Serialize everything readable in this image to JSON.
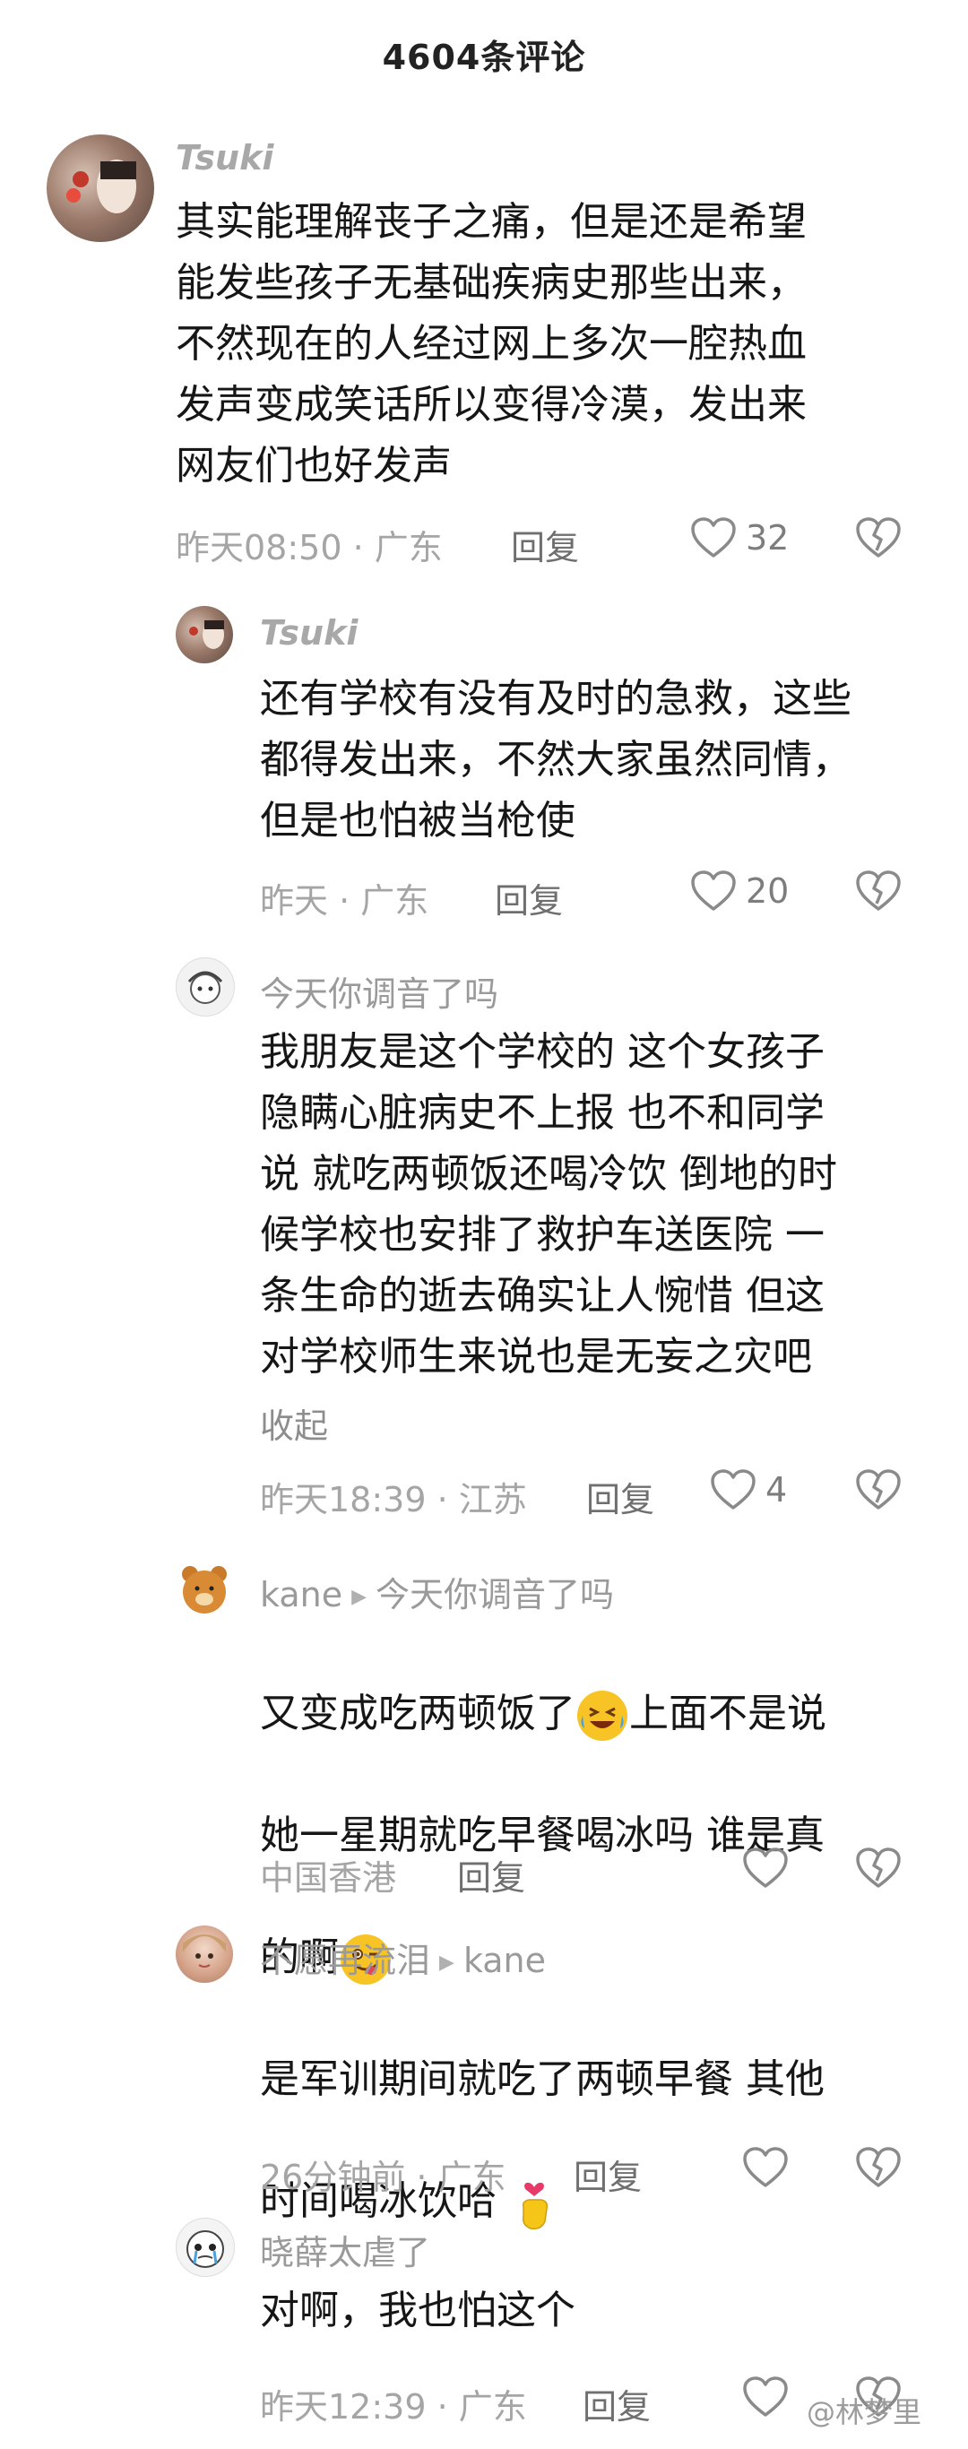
{
  "header": {
    "title": "4604条评论"
  },
  "comments": [
    {
      "user": "Tsuki",
      "text": "其实能理解丧子之痛，但是还是希望\n能发些孩子无基础疾病史那些出来，\n不然现在的人经过网上多次一腔热血\n发声变成笑话所以变得冷漠，发出来\n网友们也好发声",
      "time": "昨天08:50 · 广东",
      "reply": "回复",
      "likes": "32"
    },
    {
      "user": "Tsuki",
      "text": "还有学校有没有及时的急救，这些\n都得发出来，不然大家虽然同情，\n但是也怕被当枪使",
      "time": "昨天 · 广东",
      "reply": "回复",
      "likes": "20"
    },
    {
      "user": "今天你调音了吗",
      "text": "我朋友是这个学校的 这个女孩子\n隐瞒心脏病史不上报 也不和同学\n说 就吃两顿饭还喝冷饮 倒地的时\n候学校也安排了救护车送医院 一\n条生命的逝去确实让人惋惜 但这\n对学校师生来说也是无妄之灾吧",
      "collapse": "收起",
      "time": "昨天18:39 · 江苏",
      "reply": "回复",
      "likes": "4"
    },
    {
      "user": "kane",
      "reply_to": "今天你调音了吗",
      "text_line1": "又变成吃两顿饭了",
      "text_line1b": "上面不是说",
      "text_line2": "她一星期就吃早餐喝冰吗 谁是真",
      "text_line3": "的啊",
      "time": "中国香港",
      "reply": "回复"
    },
    {
      "user": "不愿再流泪",
      "reply_to": "kane",
      "text_line1": "是军训期间就吃了两顿早餐 其他",
      "text_line2": "时间喝冰饮哈",
      "time": "26分钟前 · 广东",
      "reply": "回复"
    },
    {
      "user": "晓薛太虐了",
      "text": "对啊，我也怕这个",
      "time": "昨天12:39 · 广东",
      "reply": "回复"
    }
  ],
  "watermark": "@林梦里",
  "icons": {
    "like": "heart-outline-icon",
    "dislike": "broken-heart-icon",
    "arrow": "play-arrow-icon"
  }
}
